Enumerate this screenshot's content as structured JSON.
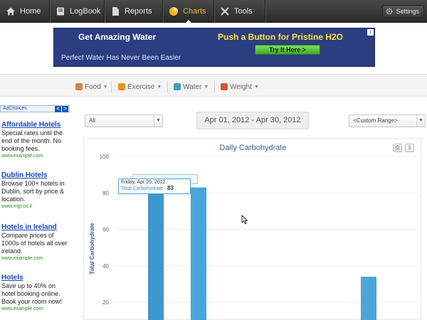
{
  "nav": {
    "items": [
      {
        "label": "Home",
        "icon": "home-icon"
      },
      {
        "label": "LogBook",
        "icon": "book-icon"
      },
      {
        "label": "Reports",
        "icon": "document-icon"
      },
      {
        "label": "Charts",
        "icon": "pie-chart-icon",
        "active": true
      },
      {
        "label": "Tools",
        "icon": "tools-icon"
      }
    ],
    "settings_label": "Settings"
  },
  "banner": {
    "headline_left": "Get Amazing Water",
    "headline_right": "Push a Button for Pristine H2O",
    "subtext": "Perfect Water Has Never Been Easier",
    "cta": "Try It Here >"
  },
  "filters": {
    "tabs": [
      {
        "label": "Food",
        "icon": "food-icon"
      },
      {
        "label": "Exercise",
        "icon": "exercise-icon"
      },
      {
        "label": "Water",
        "icon": "water-icon"
      },
      {
        "label": "Weight",
        "icon": "weight-icon"
      }
    ]
  },
  "left_ads": {
    "adchoices_label": "AdChoices",
    "ads": [
      {
        "title": "Affordable Hotels",
        "desc": "Special rates until the end of the month. No booking fees.",
        "url": "www.example.com"
      },
      {
        "title": "Dublin Hotels",
        "desc": "Browse 100+ hotels in Dublin, sort by price & location.",
        "url": "www.mgt.co.il"
      },
      {
        "title": "Hotels in Ireland",
        "desc": "Compare prices of 1000s of hotels all over ireland.",
        "url": "www.example.com"
      },
      {
        "title": "Hotels",
        "desc": "Save up to 40% on hotel booking online. Book your room now!",
        "url": "www.example.com"
      }
    ]
  },
  "controls": {
    "category_select": "All",
    "date_range": "Apr 01, 2012 - Apr 30, 2012",
    "range_select": "<Custom Range>"
  },
  "tooltip": {
    "date": "Friday, Apr 20, 2012",
    "label": "Total Carbohydrate :",
    "value": "83"
  },
  "chart_data": {
    "type": "bar",
    "title": "Daily Carbohydrate",
    "ylabel": "Total Carbohydrate",
    "xlabel": "",
    "ylim": [
      0,
      100
    ],
    "yticks": [
      20,
      40,
      60,
      80,
      100
    ],
    "grid": true,
    "visible_range": [
      17,
      100
    ],
    "series": [
      {
        "values": [
          82,
          83,
          34
        ]
      }
    ],
    "colors": {
      "bar": "#4aa6d8",
      "bar_hover": "#3d98cc",
      "axis_text": "#666666"
    }
  },
  "colors": {
    "active_nav": "#f0b42a",
    "banner_bg": "#2c3e82",
    "link": "#1a47b8",
    "ad_url": "#2a8a2a"
  }
}
